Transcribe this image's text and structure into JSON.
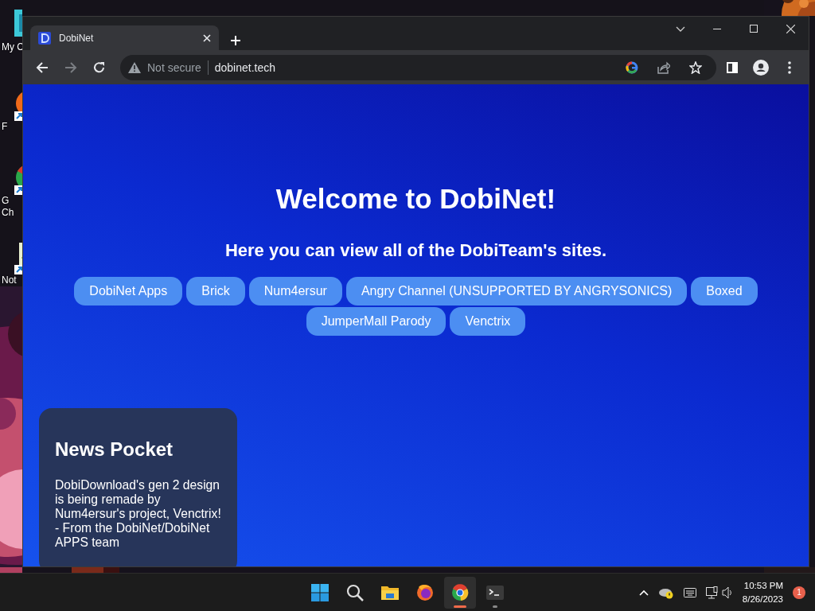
{
  "desktop": {
    "icons": [
      {
        "kind": "folder",
        "lines": [
          "My C"
        ]
      },
      {
        "kind": "firefox",
        "lines": [
          "F"
        ]
      },
      {
        "kind": "chrome",
        "lines": [
          "G",
          "Ch"
        ]
      },
      {
        "kind": "notepad",
        "lines": [
          "Not"
        ]
      }
    ]
  },
  "browser": {
    "tabs": [
      {
        "title": "DobiNet",
        "selected": true
      }
    ],
    "address": {
      "security": "Not secure",
      "url": "dobinet.tech"
    },
    "nav": [
      {
        "kind": "back",
        "disabled": false
      },
      {
        "kind": "forward",
        "disabled": true
      },
      {
        "kind": "reload",
        "disabled": false
      }
    ]
  },
  "page": {
    "heading": "Welcome to DobiNet!",
    "subheading": "Here you can view all of the DobiTeam's sites.",
    "links": [
      "DobiNet Apps",
      "Brick",
      "Num4ersur",
      "Angry Channel (UNSUPPORTED BY ANGRYSONICS)",
      "Boxed",
      "JumperMall Parody",
      "Venctrix"
    ],
    "news": {
      "title": "News Pocket",
      "body": "DobiDownload's gen 2 design is being remade by Num4ersur's project, Venctrix! - From the DobiNet/DobiNet APPS team"
    }
  },
  "taskbar": {
    "apps": [
      {
        "kind": "start",
        "selected": false,
        "running": false
      },
      {
        "kind": "search",
        "selected": false,
        "running": false
      },
      {
        "kind": "explorer",
        "selected": false,
        "running": false
      },
      {
        "kind": "firefox",
        "selected": false,
        "running": false
      },
      {
        "kind": "chrome",
        "selected": true,
        "running": true
      },
      {
        "kind": "terminal",
        "selected": false,
        "running": true
      }
    ],
    "clock": {
      "time": "10:53 PM",
      "date": "8/26/2023"
    },
    "notifications": "1"
  }
}
